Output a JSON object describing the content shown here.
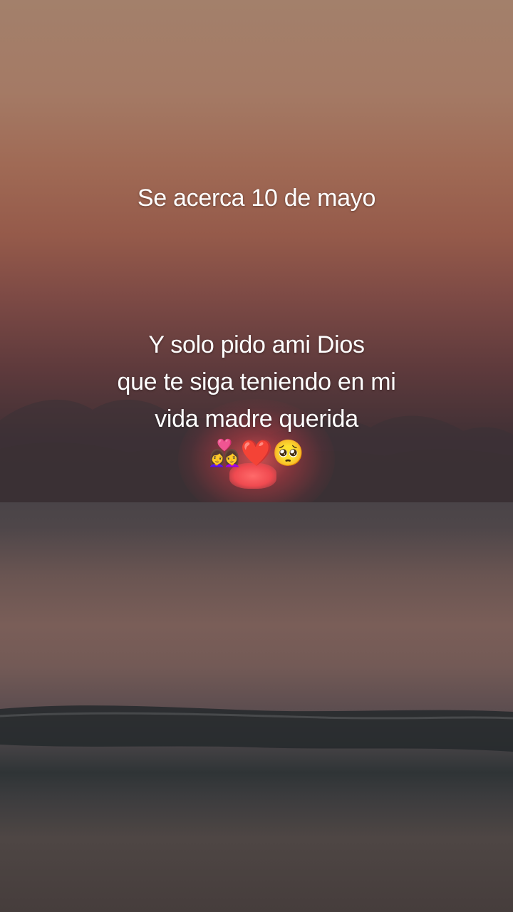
{
  "caption": {
    "headline": "Se acerca 10 de mayo",
    "message_lines": [
      "Y solo pido ami Dios",
      "que te siga teniendo en mi",
      "vida madre querida"
    ]
  },
  "emojis": {
    "couple": "👩‍❤️‍👩",
    "heart": "❤️",
    "pleading_face": "🥺"
  },
  "colors": {
    "text": "#ffffff",
    "sky_top": "#a3806b",
    "sun": "#f04a50",
    "sea": "#4a4548"
  }
}
